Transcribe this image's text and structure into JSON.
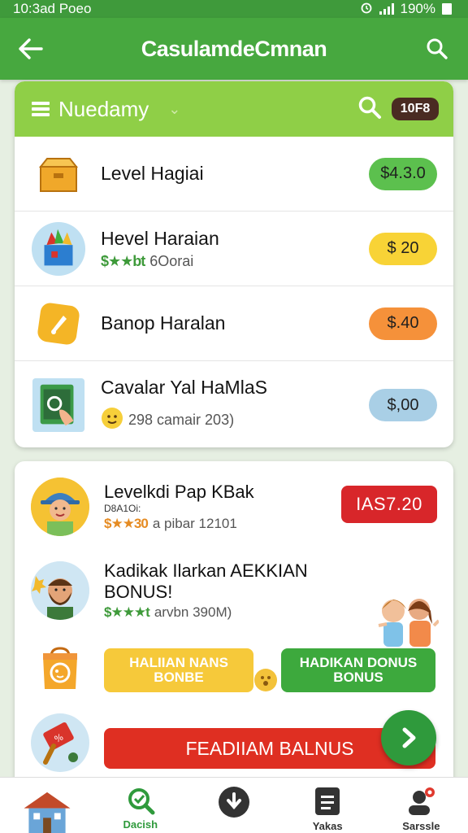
{
  "status_bar": {
    "time": "10:3ad Poeo",
    "battery": "190%"
  },
  "app_bar": {
    "title": "CasulamdeCmnan"
  },
  "filter": {
    "label": "Nuedamy",
    "count": "10F8"
  },
  "list": [
    {
      "name": "Level Hagiai",
      "sub": "",
      "stars": "",
      "price": "$4.3.0",
      "color": "#5cc04e"
    },
    {
      "name": "Hevel Haraian",
      "sub": "6Oorai",
      "stars": "$★★bt",
      "price": "$ 20",
      "color": "#f8d336"
    },
    {
      "name": "Banop Haralan",
      "sub": "",
      "stars": "",
      "price": "$.40",
      "color": "#f5913a"
    },
    {
      "name": "Cavalar Yal HaMlaS",
      "sub": "298 camair 203)",
      "stars": "",
      "price": "$,00",
      "color": "#a9cfe6"
    }
  ],
  "bonus": {
    "row1": {
      "title": "Levelkdi Pap KBak",
      "small": "D8A1Oi:",
      "stars": "$★★30",
      "sub": "a pibar 12101",
      "tag": "IAS7.20"
    },
    "row2": {
      "title": "Kadikak Ilarkan AEKKIAN BONUS!",
      "stars": "$★★★t",
      "sub": "arvbn 390M)"
    },
    "btn_yellow": {
      "line1": "HALIIAN NANS",
      "line2": "BONBE"
    },
    "btn_green": {
      "line1": "HADIKAN DONUS",
      "line2": "BONUS"
    },
    "btn_red": "FEADIIAM BALNUS"
  },
  "nav": [
    {
      "label": ""
    },
    {
      "label": "Dacish"
    },
    {
      "label": ""
    },
    {
      "label": "Yakas"
    },
    {
      "label": "Sarssle"
    }
  ],
  "colors": {
    "primary": "#47a83f",
    "filter": "#8fcf47",
    "red": "#d8262a"
  }
}
